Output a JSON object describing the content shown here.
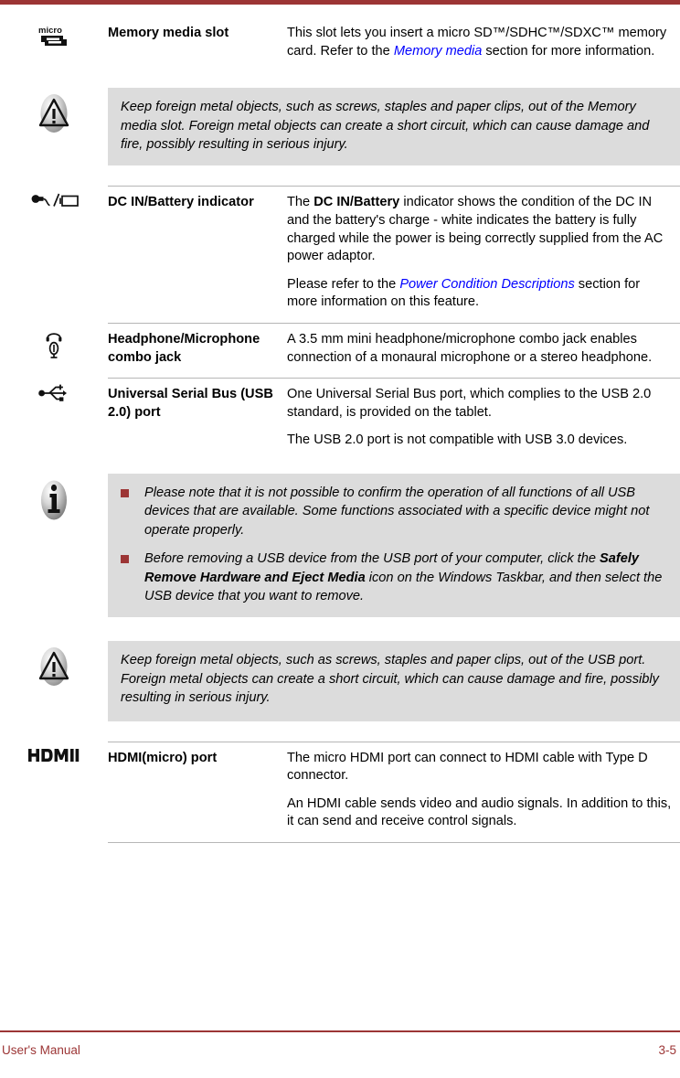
{
  "document": {
    "accent_color": "#9c3535",
    "link_color": "#0000ff",
    "note_bg_color": "#dcdcdc"
  },
  "footer": {
    "left_label": "User's Manual",
    "page_number": "3-5"
  },
  "rows": [
    {
      "icon": "micro-sd-card-icon",
      "name": "Memory media slot",
      "desc_1_a": "This slot lets you insert a micro SD™/SDHC™/SDXC™ memory card. Refer to the ",
      "desc_1_link": "Memory media",
      "desc_1_b": " section for more information."
    },
    {
      "icon": "caution-triangle-icon",
      "note": "Keep foreign metal objects, such as screws, staples and paper clips, out of the Memory media slot. Foreign metal objects can create a short circuit, which can cause damage and fire, possibly resulting in serious injury."
    },
    {
      "icon": "dc-in-battery-icon",
      "name": "DC IN/Battery indicator",
      "desc_1_a": "The ",
      "desc_1_bold": "DC IN/Battery",
      "desc_1_b": " indicator shows the condition of the DC IN and the battery's charge - white indicates the battery is fully charged while the power is being correctly supplied from the AC power adaptor.",
      "desc_2_a": "Please refer to the ",
      "desc_2_link": "Power Condition Descriptions",
      "desc_2_b": " section for more information on this feature."
    },
    {
      "icon": "headphone-microphone-icon",
      "name": "Headphone/Microphone combo jack",
      "desc_1": "A 3.5 mm mini headphone/microphone combo jack enables connection of a monaural microphone or a stereo headphone."
    },
    {
      "icon": "usb-icon",
      "name": "Universal Serial Bus (USB 2.0) port",
      "desc_1": "One Universal Serial Bus port, which complies to the USB 2.0 standard, is provided on the tablet.",
      "desc_2": "The USB 2.0 port is not compatible with USB 3.0 devices."
    },
    {
      "icon": "info-circle-icon",
      "bullets": [
        {
          "text_a": "Please note that it is not possible to confirm the operation of all functions of all USB devices that are available. Some functions associated with a specific device might not operate properly."
        },
        {
          "text_a": "Before removing a USB device from the USB port of your computer, click the ",
          "bold": "Safely Remove Hardware and Eject Media",
          "text_b": " icon on the Windows Taskbar, and then select the USB device that you want to remove."
        }
      ]
    },
    {
      "icon": "caution-triangle-icon",
      "note": "Keep foreign metal objects, such as screws, staples and paper clips, out of the USB port. Foreign metal objects can create a short circuit, which can cause damage and fire, possibly resulting in serious injury."
    },
    {
      "icon": "hdmi-logo-icon",
      "name": "HDMI(micro) port",
      "desc_1": "The micro HDMI port can connect to HDMI cable with Type D connector.",
      "desc_2": "An HDMI cable sends video and audio signals. In addition to this, it can send and receive control signals."
    }
  ]
}
